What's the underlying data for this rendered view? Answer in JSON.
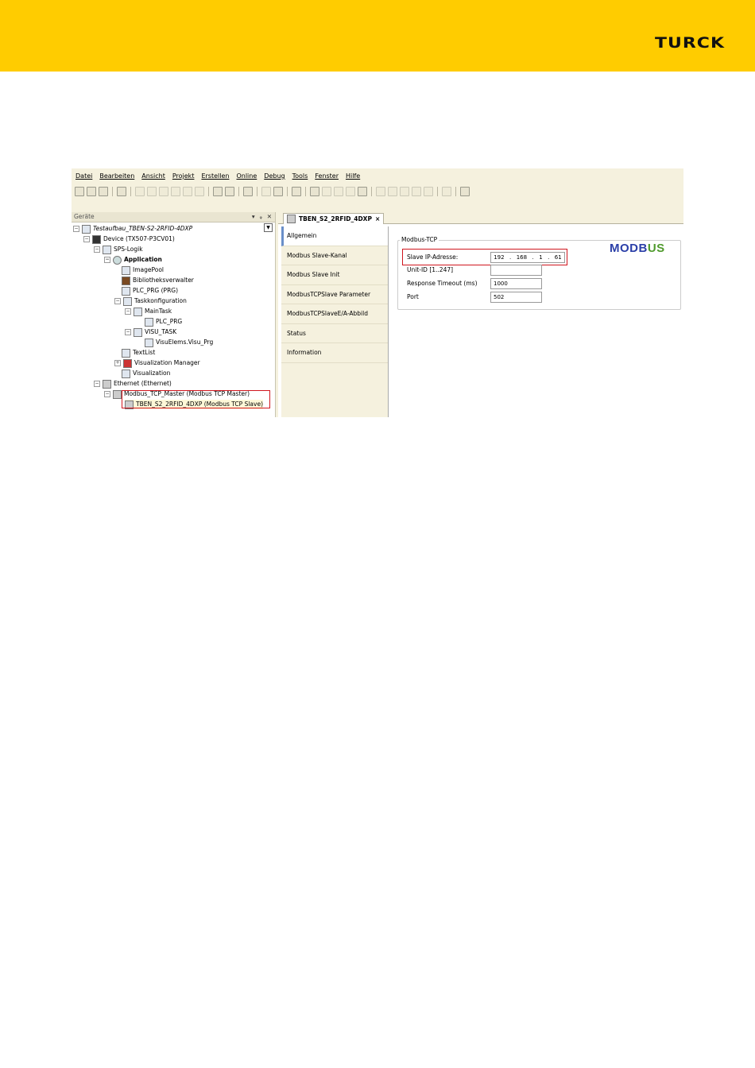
{
  "header": {
    "brand": "TURCK",
    "bg_color": "#FFCC00"
  },
  "menu": [
    "Datei",
    "Bearbeiten",
    "Ansicht",
    "Projekt",
    "Erstellen",
    "Online",
    "Debug",
    "Tools",
    "Fenster",
    "Hilfe"
  ],
  "devices_panel": {
    "title": "Geräte",
    "tree": [
      {
        "label": "Testaufbau_TBEN-S2-2RFID-4DXP",
        "level": 0
      },
      {
        "label": "Device (TX507-P3CV01)",
        "level": 1
      },
      {
        "label": "SPS-Logik",
        "level": 2
      },
      {
        "label": "Application",
        "level": 3
      },
      {
        "label": "ImagePool",
        "level": 4
      },
      {
        "label": "Bibliotheksverwalter",
        "level": 4
      },
      {
        "label": "PLC_PRG (PRG)",
        "level": 4
      },
      {
        "label": "Taskkonfiguration",
        "level": 4
      },
      {
        "label": "MainTask",
        "level": 5
      },
      {
        "label": "PLC_PRG",
        "level": 6
      },
      {
        "label": "VISU_TASK",
        "level": 5
      },
      {
        "label": "VisuElems.Visu_Prg",
        "level": 6
      },
      {
        "label": "TextList",
        "level": 4
      },
      {
        "label": "Visualization Manager",
        "level": 4
      },
      {
        "label": "Visualization",
        "level": 4
      },
      {
        "label": "Ethernet (Ethernet)",
        "level": 2
      },
      {
        "label": "Modbus_TCP_Master (Modbus TCP Master)",
        "level": 3
      },
      {
        "label": "TBEN_S2_2RFID_4DXP (Modbus TCP Slave)",
        "level": 4
      }
    ]
  },
  "editor": {
    "tab_label": "TBEN_S2_2RFID_4DXP",
    "tab_close": "×",
    "nav": [
      "Allgemein",
      "Modbus Slave-Kanal",
      "Modbus Slave Init",
      "ModbusTCPSlave Parameter",
      "ModbusTCPSlaveE/A-Abbild",
      "Status",
      "Information"
    ],
    "active_nav": "Allgemein",
    "group_title": "Modbus-TCP",
    "fields": {
      "ip_label": "Slave IP-Adresse:",
      "ip_parts": [
        "192",
        "168",
        "1",
        "61"
      ],
      "unit_label": "Unit-ID [1..247]",
      "unit_value": "",
      "timeout_label": "Response Timeout (ms)",
      "timeout_value": "1000",
      "port_label": "Port",
      "port_value": "502"
    },
    "logo": {
      "part1": "MODB",
      "part2": "US"
    }
  }
}
